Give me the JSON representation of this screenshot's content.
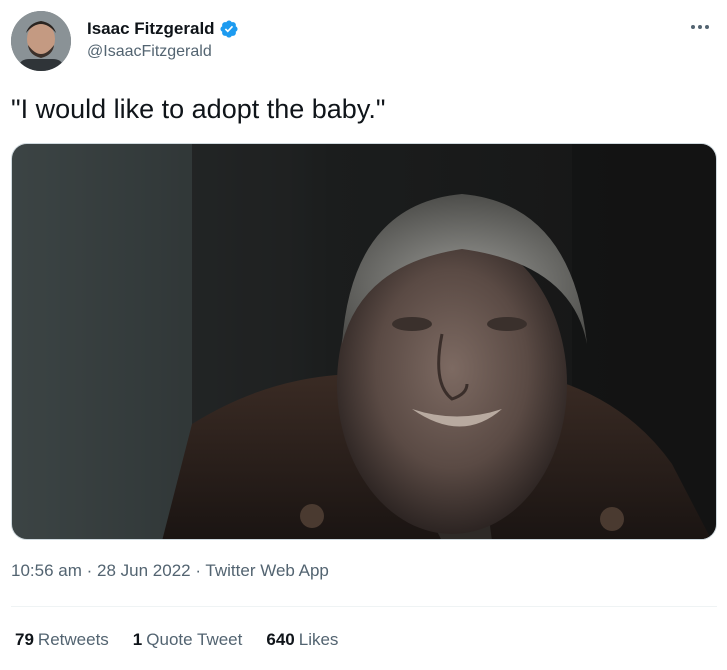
{
  "author": {
    "display_name": "Isaac Fitzgerald",
    "handle": "@IsaacFitzgerald",
    "verified_icon": "verified-badge-icon",
    "verified_color": "#1d9bf0"
  },
  "tweet": {
    "text": "\"I would like to adopt the baby.\""
  },
  "meta": {
    "time": "10:56 am",
    "separator": "·",
    "date": "28 Jun 2022",
    "source": "Twitter Web App"
  },
  "stats": {
    "retweets_count": "79",
    "retweets_label": "Retweets",
    "quotes_count": "1",
    "quotes_label": "Quote Tweet",
    "likes_count": "640",
    "likes_label": "Likes"
  },
  "icons": {
    "more": "more-horizontal-icon"
  },
  "colors": {
    "text_primary": "#0f1419",
    "text_secondary": "#536471",
    "border": "#cfd9de",
    "divider": "#eff3f4"
  }
}
